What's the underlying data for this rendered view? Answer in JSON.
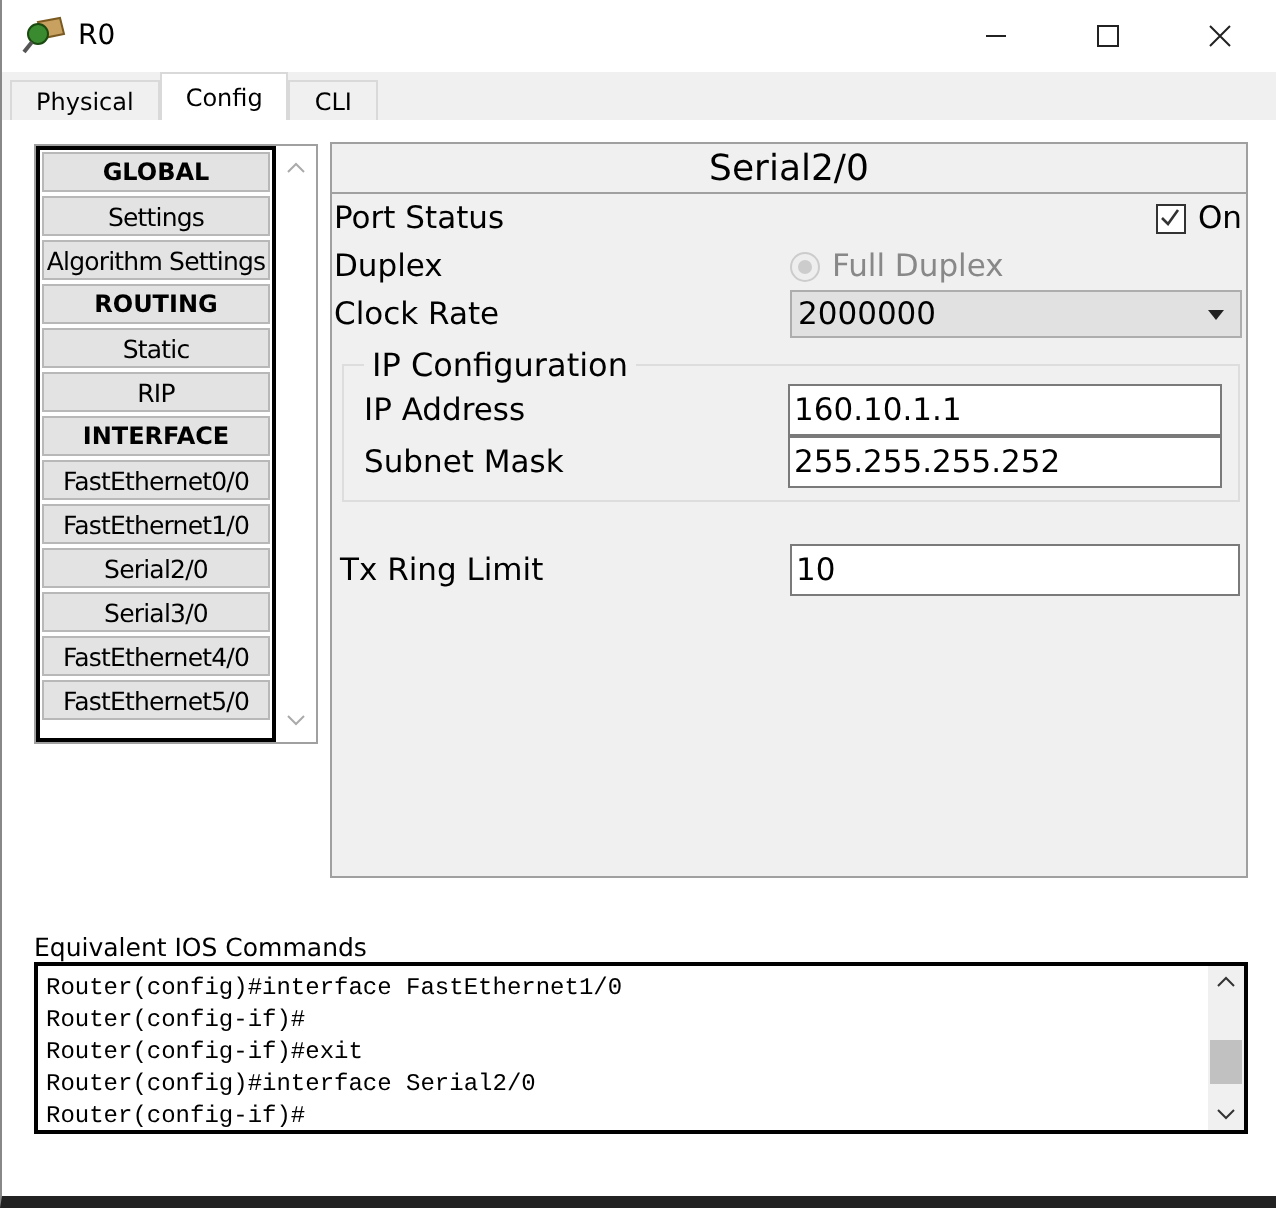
{
  "window": {
    "title": "R0"
  },
  "tabs": [
    {
      "label": "Physical",
      "selected": false
    },
    {
      "label": "Config",
      "selected": true
    },
    {
      "label": "CLI",
      "selected": false
    }
  ],
  "sidebar": {
    "items": [
      {
        "label": "GLOBAL",
        "kind": "header"
      },
      {
        "label": "Settings",
        "kind": "item"
      },
      {
        "label": "Algorithm Settings",
        "kind": "item"
      },
      {
        "label": "ROUTING",
        "kind": "header"
      },
      {
        "label": "Static",
        "kind": "item"
      },
      {
        "label": "RIP",
        "kind": "item"
      },
      {
        "label": "INTERFACE",
        "kind": "header"
      },
      {
        "label": "FastEthernet0/0",
        "kind": "item"
      },
      {
        "label": "FastEthernet1/0",
        "kind": "item"
      },
      {
        "label": "Serial2/0",
        "kind": "item"
      },
      {
        "label": "Serial3/0",
        "kind": "item"
      },
      {
        "label": "FastEthernet4/0",
        "kind": "item"
      },
      {
        "label": "FastEthernet5/0",
        "kind": "item"
      }
    ]
  },
  "panel": {
    "title": "Serial2/0",
    "port_status": {
      "label": "Port Status",
      "checked": true,
      "option": "On"
    },
    "duplex": {
      "label": "Duplex",
      "option": "Full Duplex",
      "disabled": true
    },
    "clock_rate": {
      "label": "Clock Rate",
      "value": "2000000"
    },
    "ip_configuration": {
      "title": "IP Configuration",
      "ip_address": {
        "label": "IP Address",
        "value": "160.10.1.1"
      },
      "subnet_mask": {
        "label": "Subnet Mask",
        "value": "255.255.255.252"
      }
    },
    "tx_ring_limit": {
      "label": "Tx Ring Limit",
      "value": "10"
    }
  },
  "console": {
    "title": "Equivalent IOS Commands",
    "lines": [
      "Router(config)#interface FastEthernet1/0",
      "Router(config-if)#",
      "Router(config-if)#exit",
      "Router(config)#interface Serial2/0",
      "Router(config-if)#"
    ]
  }
}
